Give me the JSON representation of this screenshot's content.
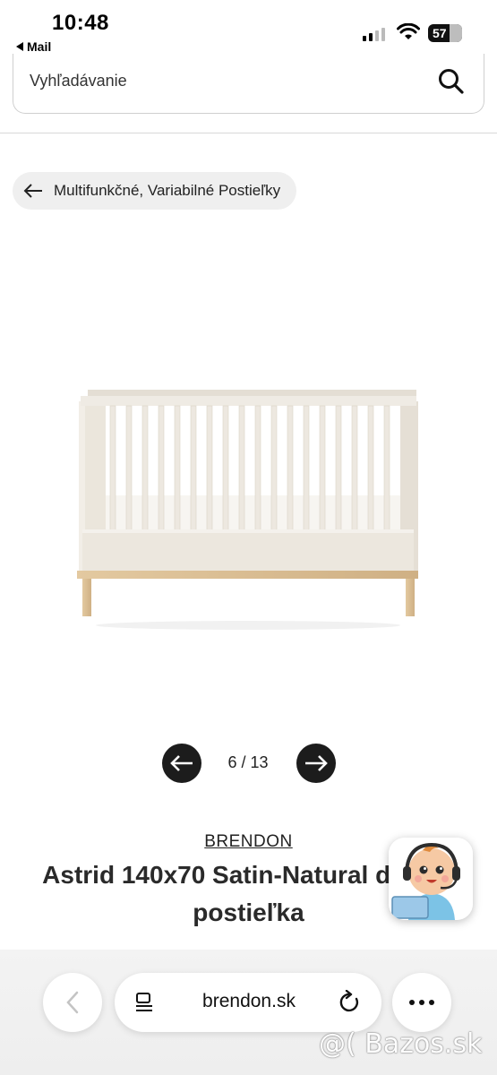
{
  "status_bar": {
    "time": "10:48",
    "back_app": "Mail",
    "battery": "57"
  },
  "search": {
    "placeholder": "Vyhľadávanie",
    "icon": "search-icon"
  },
  "breadcrumb": {
    "label": "Multifunkčné, Variabilné Postieľky",
    "icon": "arrow-left-icon"
  },
  "gallery": {
    "counter": "6 / 13",
    "current": 6,
    "total": 13
  },
  "product": {
    "brand": "BRENDON",
    "title": "Astrid 140x70 Satin-Natural detská postieľka"
  },
  "browser": {
    "url": "brendon.sk"
  },
  "watermark": "@( Bazos.sk",
  "colors": {
    "pager_button": "#1c1c1c",
    "breadcrumb_bg": "#efefef",
    "crib_frame": "#ece7de",
    "crib_legs": "#d9bf96"
  }
}
